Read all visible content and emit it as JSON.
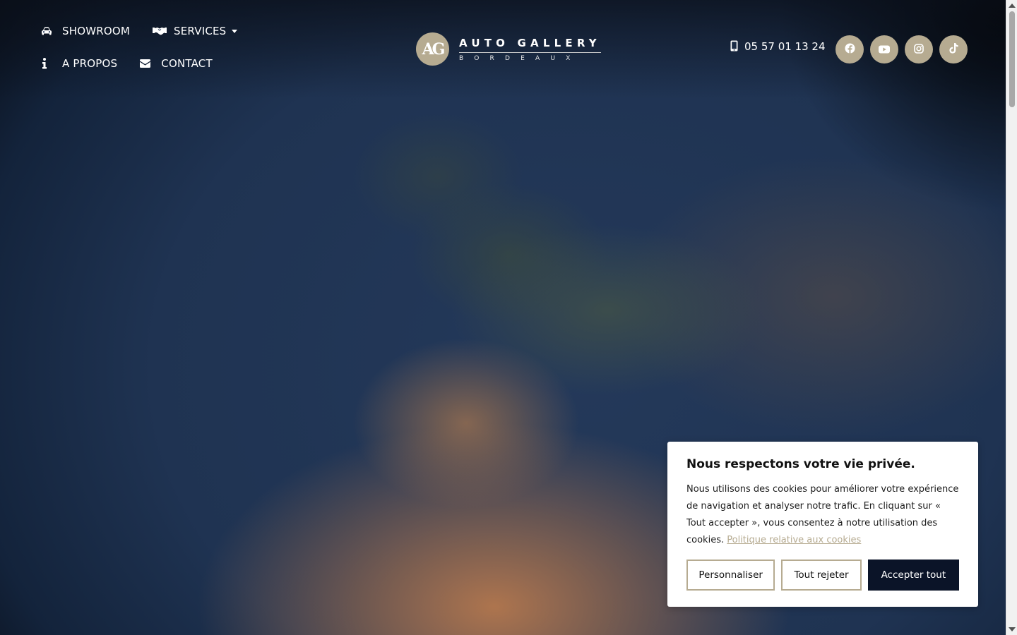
{
  "nav": {
    "items": [
      {
        "label": "SHOWROOM",
        "icon": "car-icon"
      },
      {
        "label": "SERVICES",
        "icon": "handshake-icon",
        "dropdown": true
      },
      {
        "label": "A PROPOS",
        "icon": "info-icon"
      },
      {
        "label": "CONTACT",
        "icon": "envelope-icon"
      }
    ]
  },
  "logo": {
    "monogram": "AG",
    "title": "AUTO GALLERY",
    "subtitle": "BORDEAUX"
  },
  "phone": {
    "number": "05 57 01 13 24",
    "icon": "mobile-phone-icon"
  },
  "social": [
    {
      "name": "facebook-icon"
    },
    {
      "name": "youtube-icon"
    },
    {
      "name": "instagram-icon"
    },
    {
      "name": "tiktok-icon"
    }
  ],
  "cookie": {
    "title": "Nous respectons votre vie privée.",
    "text": "Nous utilisons des cookies pour améliorer votre expérience de navigation et analyser notre trafic. En cliquant sur « Tout accepter », vous consentez à notre utilisation des cookies.",
    "link": "Politique relative aux cookies",
    "customize": "Personnaliser",
    "reject": "Tout rejeter",
    "accept": "Accepter tout"
  },
  "colors": {
    "accent": "#b6ab91",
    "dark_button": "#0b1428"
  }
}
